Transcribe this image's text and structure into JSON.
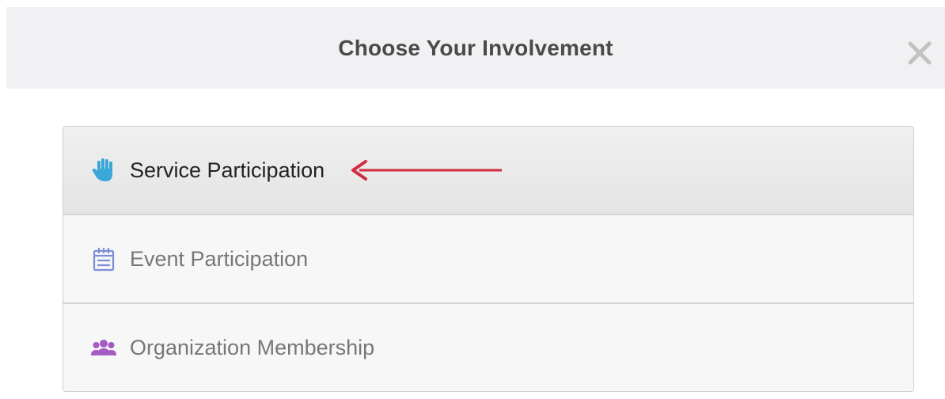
{
  "modal": {
    "title": "Choose Your Involvement",
    "close_icon": "close-icon"
  },
  "options": [
    {
      "label": "Service Participation",
      "icon": "hand-icon",
      "icon_color": "#3aa7d8",
      "state": "hover"
    },
    {
      "label": "Event Participation",
      "icon": "calendar-icon",
      "icon_color": "#7d8ed8"
    },
    {
      "label": "Organization Membership",
      "icon": "group-icon",
      "icon_color": "#a45bc4"
    }
  ],
  "annotation": {
    "icon": "arrow-left-icon",
    "color": "#d22b3f"
  }
}
